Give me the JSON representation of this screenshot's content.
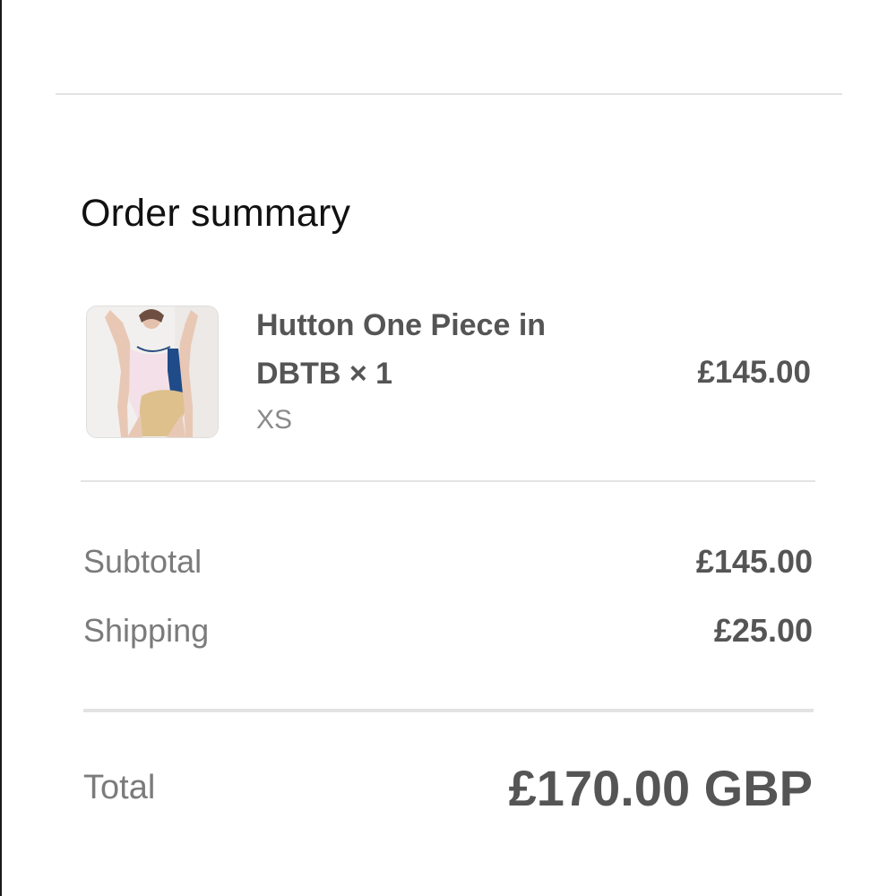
{
  "order_summary": {
    "title": "Order summary"
  },
  "line_item": {
    "name": "Hutton One Piece in DBTB × 1",
    "variant": "XS",
    "price": "£145.00",
    "image_icon": "product-photo-icon"
  },
  "totals": {
    "subtotal_label": "Subtotal",
    "subtotal_value": "£145.00",
    "shipping_label": "Shipping",
    "shipping_value": "£25.00",
    "total_label": "Total",
    "total_value": "£170.00 GBP"
  },
  "colors": {
    "title": "#111111",
    "muted_text": "#7b7b7b",
    "emphasis_text": "#555555",
    "divider": "#e3e3e3"
  }
}
